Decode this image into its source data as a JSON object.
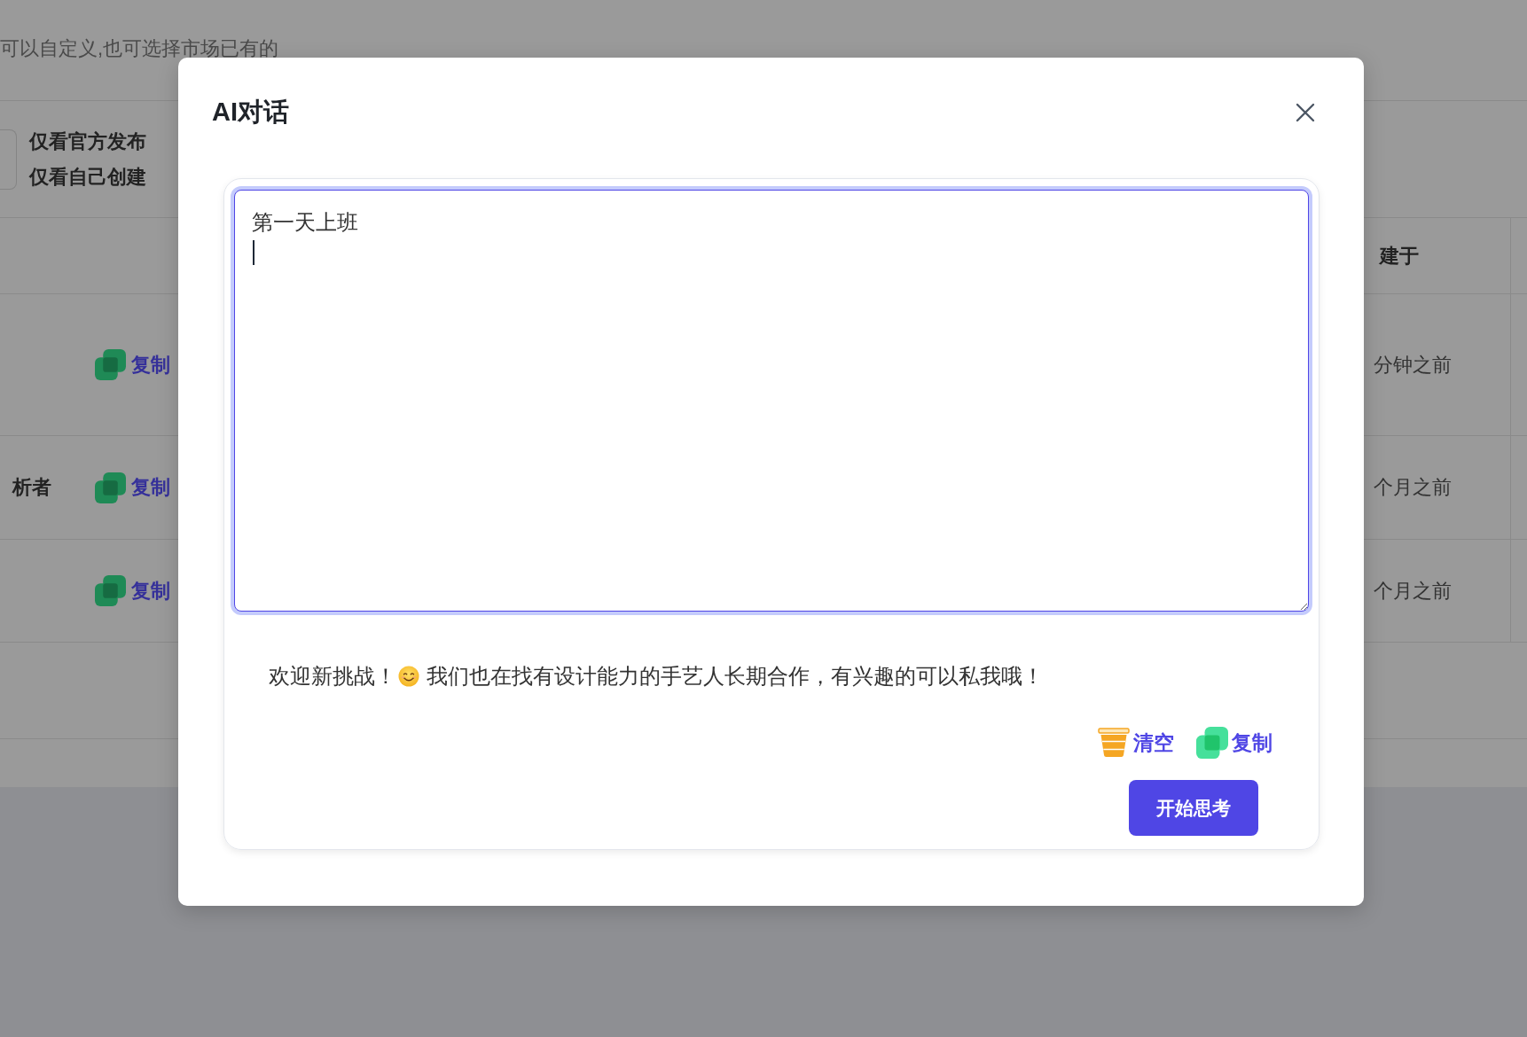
{
  "background_page": {
    "intro_text": "可以自定义,也可选择市场已有的",
    "filter_options": [
      "仅看官方发布",
      "仅看自己创建"
    ],
    "table": {
      "created_header": "建于",
      "rows": [
        {
          "action": "复制",
          "created": "分钟之前"
        },
        {
          "column_1": "析者",
          "action": "复制",
          "created": "个月之前"
        },
        {
          "action": "复制",
          "created": "个月之前"
        }
      ]
    }
  },
  "dialog": {
    "title": "AI对话",
    "prompt_field": {
      "value": "第一天上班",
      "focused": true
    },
    "reply_segments": [
      {
        "kind": "text",
        "text": "欢迎新挑战！"
      },
      {
        "kind": "emoji"
      },
      {
        "kind": "text",
        "text": "我们也在找有设计能力的手艺人长期合作，有兴趣的可以私我哦！"
      }
    ],
    "actions": [
      {
        "kind": "clear",
        "label": "清空"
      },
      {
        "kind": "copy",
        "label": "复制"
      }
    ],
    "submit_button": {
      "label": "开始思考"
    }
  }
}
